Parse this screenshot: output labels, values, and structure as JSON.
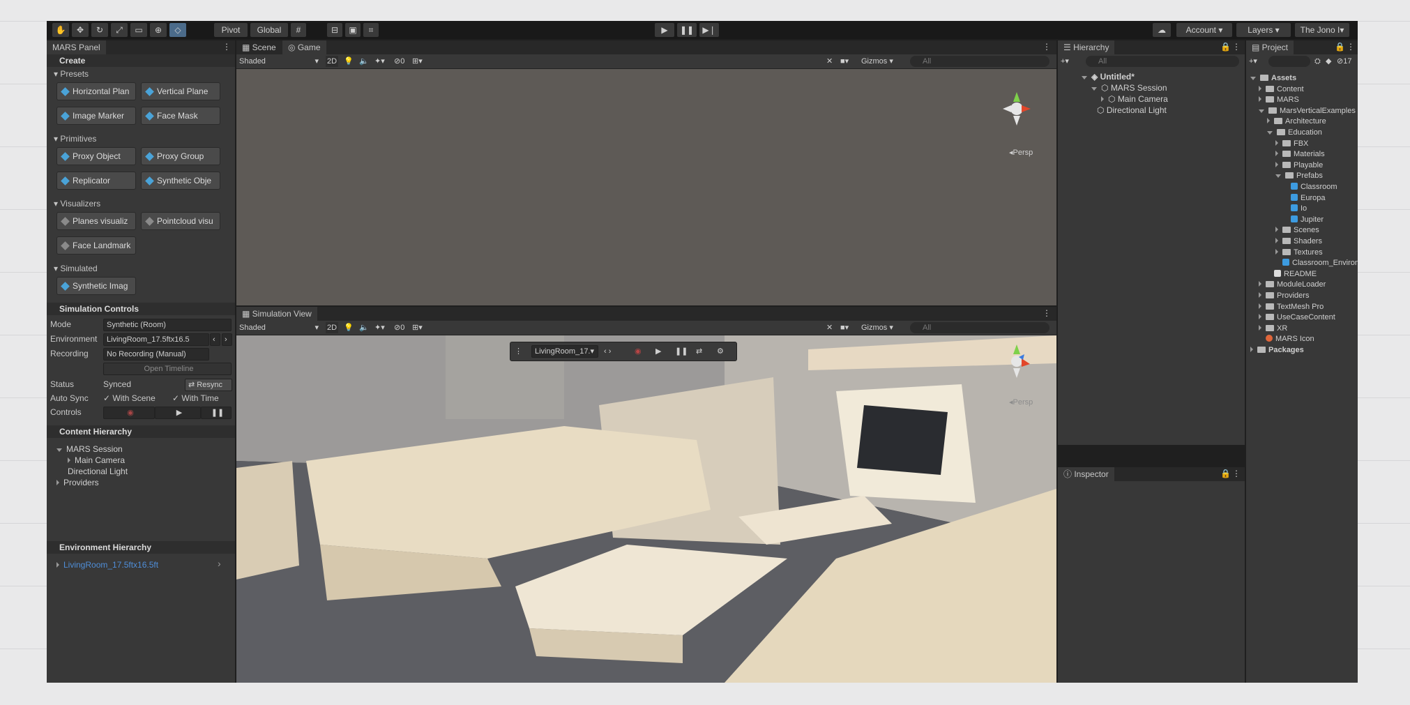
{
  "toolbar": {
    "pivot": "Pivot",
    "global": "Global",
    "account": "Account",
    "layers": "Layers",
    "user": "The Jono I"
  },
  "mars_panel": {
    "tab": "MARS Panel",
    "create": "Create",
    "presets_label": "Presets",
    "presets": [
      "Horizontal Plan",
      "Vertical Plane",
      "Image Marker",
      "Face Mask"
    ],
    "primitives_label": "Primitives",
    "primitives": [
      "Proxy Object",
      "Proxy Group",
      "Replicator",
      "Synthetic Obje"
    ],
    "visualizers_label": "Visualizers",
    "visualizers": [
      "Planes visualiz",
      "Pointcloud visu",
      "Face Landmark"
    ],
    "simulated_label": "Simulated",
    "simulated": [
      "Synthetic Imag"
    ],
    "sim_controls": "Simulation Controls",
    "mode_label": "Mode",
    "mode_value": "Synthetic (Room)",
    "env_label": "Environment",
    "env_value": "LivingRoom_17.5ftx16.5",
    "recording_label": "Recording",
    "recording_value": "No Recording (Manual)",
    "open_timeline": "Open Timeline",
    "status_label": "Status",
    "status_value": "Synced",
    "resync": "Resync",
    "autosync_label": "Auto Sync",
    "with_scene": "With Scene",
    "with_time": "With Time",
    "controls_label": "Controls",
    "content_hierarchy": "Content Hierarchy",
    "content_items": [
      "MARS Session",
      "Main Camera",
      "Directional Light",
      "Providers"
    ],
    "env_hierarchy": "Environment Hierarchy",
    "env_item": "LivingRoom_17.5ftx16.5ft"
  },
  "scene": {
    "tab_scene": "Scene",
    "tab_game": "Game",
    "shaded": "Shaded",
    "mode2d": "2D",
    "gizmos": "Gizmos",
    "search": "All",
    "persp": "Persp",
    "hidden_count": "0"
  },
  "simulation_view": {
    "tab": "Simulation View",
    "shaded": "Shaded",
    "mode2d": "2D",
    "gizmos": "Gizmos",
    "search": "All",
    "persp": "Persp",
    "hidden_count": "0",
    "env_dropdown": "LivingRoom_17."
  },
  "hierarchy": {
    "tab": "Hierarchy",
    "search": "All",
    "scene_name": "Untitled*",
    "items": [
      "MARS Session",
      "Main Camera",
      "Directional Light"
    ]
  },
  "inspector": {
    "tab": "Inspector"
  },
  "project": {
    "tab": "Project",
    "count": "17",
    "items": [
      {
        "label": "Assets",
        "kind": "folder-open"
      },
      {
        "label": "Content",
        "kind": "folder"
      },
      {
        "label": "MARS",
        "kind": "folder"
      },
      {
        "label": "MarsVerticalExamples",
        "kind": "folder-open"
      },
      {
        "label": "Architecture",
        "kind": "folder"
      },
      {
        "label": "Education",
        "kind": "folder-open"
      },
      {
        "label": "FBX",
        "kind": "folder"
      },
      {
        "label": "Materials",
        "kind": "folder"
      },
      {
        "label": "Playable",
        "kind": "folder"
      },
      {
        "label": "Prefabs",
        "kind": "folder-open"
      },
      {
        "label": "Classroom",
        "kind": "prefab"
      },
      {
        "label": "Europa",
        "kind": "prefab"
      },
      {
        "label": "Io",
        "kind": "prefab"
      },
      {
        "label": "Jupiter",
        "kind": "prefab"
      },
      {
        "label": "Scenes",
        "kind": "folder"
      },
      {
        "label": "Shaders",
        "kind": "folder"
      },
      {
        "label": "Textures",
        "kind": "folder"
      },
      {
        "label": "Classroom_Environment",
        "kind": "prefab"
      },
      {
        "label": "README",
        "kind": "file"
      },
      {
        "label": "ModuleLoader",
        "kind": "folder"
      },
      {
        "label": "Providers",
        "kind": "folder"
      },
      {
        "label": "TextMesh Pro",
        "kind": "folder"
      },
      {
        "label": "UseCaseContent",
        "kind": "folder"
      },
      {
        "label": "XR",
        "kind": "folder"
      },
      {
        "label": "MARS Icon",
        "kind": "icon"
      },
      {
        "label": "Packages",
        "kind": "folder"
      }
    ]
  }
}
